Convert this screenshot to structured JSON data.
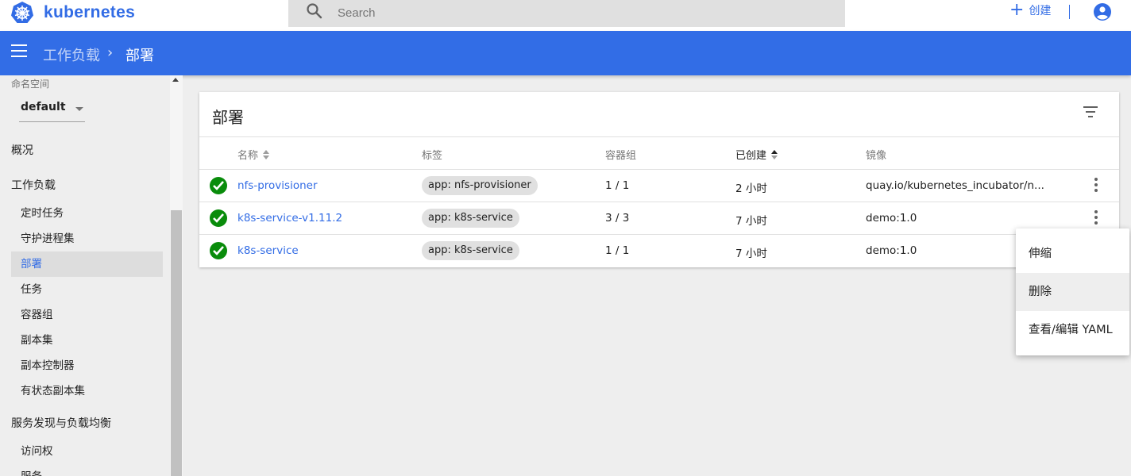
{
  "topbar": {
    "brand": "kubernetes",
    "search_placeholder": "Search",
    "create_label": "创建",
    "separator": "|",
    "logo_icon": "kubernetes-wheel-icon",
    "account_icon": "account-circle-icon",
    "brand_color": "#326ce5"
  },
  "header": {
    "breadcrumb_parent": "工作负载",
    "breadcrumb_current": "部署",
    "chevron": "›",
    "accent": "#326de6"
  },
  "sidebar": {
    "namespace_label": "命名空间",
    "namespace_value": "default",
    "overview": "概况",
    "workloads": "工作负载",
    "workload_items": [
      "定时任务",
      "守护进程集",
      "部署",
      "任务",
      "容器组",
      "副本集",
      "副本控制器",
      "有状态副本集"
    ],
    "active_item": "部署",
    "discovery": "服务发现与负载均衡",
    "discovery_items": [
      "访问权",
      "服务"
    ]
  },
  "card": {
    "title": "部署",
    "columns": {
      "name": "名称",
      "labels": "标签",
      "pods": "容器组",
      "created": "已创建",
      "image": "镜像"
    },
    "sorted_column": "已创建",
    "rows": [
      {
        "status": "running",
        "name": "nfs-provisioner",
        "label": "app: nfs-provisioner",
        "pods": "1 / 1",
        "created": "2 小时",
        "image": "quay.io/kubernetes_incubator/n..."
      },
      {
        "status": "running",
        "name": "k8s-service-v1.11.2",
        "label": "app: k8s-service",
        "pods": "3 / 3",
        "created": "7 小时",
        "image": "demo:1.0"
      },
      {
        "status": "running",
        "name": "k8s-service",
        "label": "app: k8s-service",
        "pods": "1 / 1",
        "created": "7 小时",
        "image": "demo:1.0"
      }
    ]
  },
  "context_menu": {
    "items": [
      "伸缩",
      "删除",
      "查看/编辑 YAML"
    ],
    "hovered": "删除"
  }
}
